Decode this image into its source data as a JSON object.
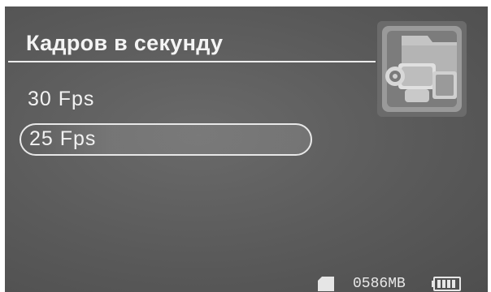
{
  "header": {
    "title": "Кадров в секунду"
  },
  "menu": {
    "items": [
      {
        "label": "30 Fps",
        "selected": false
      },
      {
        "label": "25 Fps",
        "selected": true
      }
    ]
  },
  "status": {
    "storage": "0586MB"
  },
  "icons": {
    "app": "video-camera-icon",
    "storage": "sd-card-icon",
    "battery": "battery-icon"
  },
  "colors": {
    "background": "#5e5e5e",
    "text": "#f2f2f2",
    "highlight_border": "#e8e8e8"
  }
}
